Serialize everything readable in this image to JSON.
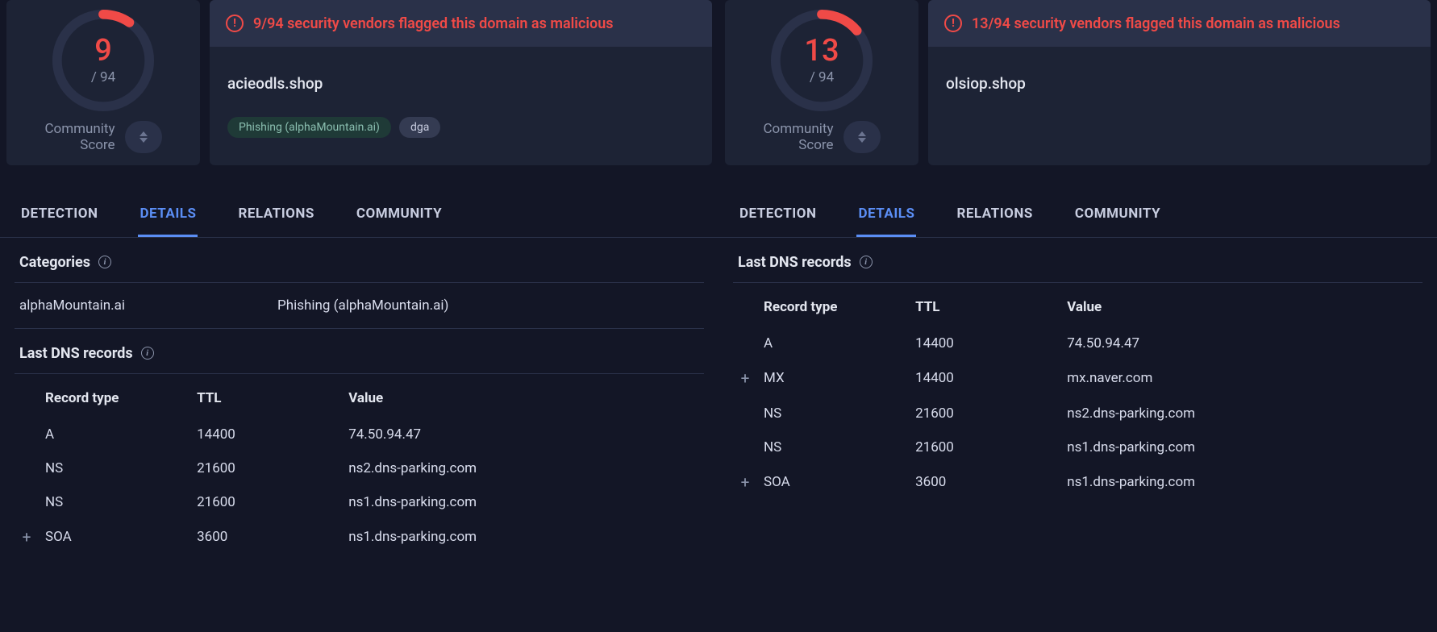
{
  "left": {
    "score": "9",
    "total": "/ 94",
    "community_label_1": "Community",
    "community_label_2": "Score",
    "alert_text": "9/94 security vendors flagged this domain as malicious",
    "domain": "acieodls.shop",
    "tags": [
      {
        "label": "Phishing (alphaMountain.ai)",
        "class": "green"
      },
      {
        "label": "dga",
        "class": ""
      }
    ],
    "tabs": [
      "DETECTION",
      "DETAILS",
      "RELATIONS",
      "COMMUNITY"
    ],
    "active_tab": 1,
    "categories": {
      "heading": "Categories",
      "rows": [
        {
          "key": "alphaMountain.ai",
          "val": "Phishing (alphaMountain.ai)"
        }
      ]
    },
    "dns": {
      "heading": "Last DNS records",
      "headers": [
        "Record type",
        "TTL",
        "Value"
      ],
      "rows": [
        {
          "expand": "",
          "type": "A",
          "ttl": "14400",
          "val": "74.50.94.47"
        },
        {
          "expand": "",
          "type": "NS",
          "ttl": "21600",
          "val": "ns2.dns-parking.com"
        },
        {
          "expand": "",
          "type": "NS",
          "ttl": "21600",
          "val": "ns1.dns-parking.com"
        },
        {
          "expand": "+",
          "type": "SOA",
          "ttl": "3600",
          "val": "ns1.dns-parking.com"
        }
      ]
    },
    "gauge_fraction": 0.096
  },
  "right": {
    "score": "13",
    "total": "/ 94",
    "community_label_1": "Community",
    "community_label_2": "Score",
    "alert_text": "13/94 security vendors flagged this domain as malicious",
    "domain": "olsiop.shop",
    "tags": [],
    "tabs": [
      "DETECTION",
      "DETAILS",
      "RELATIONS",
      "COMMUNITY"
    ],
    "active_tab": 1,
    "dns": {
      "heading": "Last DNS records",
      "headers": [
        "Record type",
        "TTL",
        "Value"
      ],
      "rows": [
        {
          "expand": "",
          "type": "A",
          "ttl": "14400",
          "val": "74.50.94.47"
        },
        {
          "expand": "+",
          "type": "MX",
          "ttl": "14400",
          "val": "mx.naver.com"
        },
        {
          "expand": "",
          "type": "NS",
          "ttl": "21600",
          "val": "ns2.dns-parking.com"
        },
        {
          "expand": "",
          "type": "NS",
          "ttl": "21600",
          "val": "ns1.dns-parking.com"
        },
        {
          "expand": "+",
          "type": "SOA",
          "ttl": "3600",
          "val": "ns1.dns-parking.com"
        }
      ]
    },
    "gauge_fraction": 0.138
  },
  "icons": {
    "info": "i",
    "alert": "!"
  }
}
